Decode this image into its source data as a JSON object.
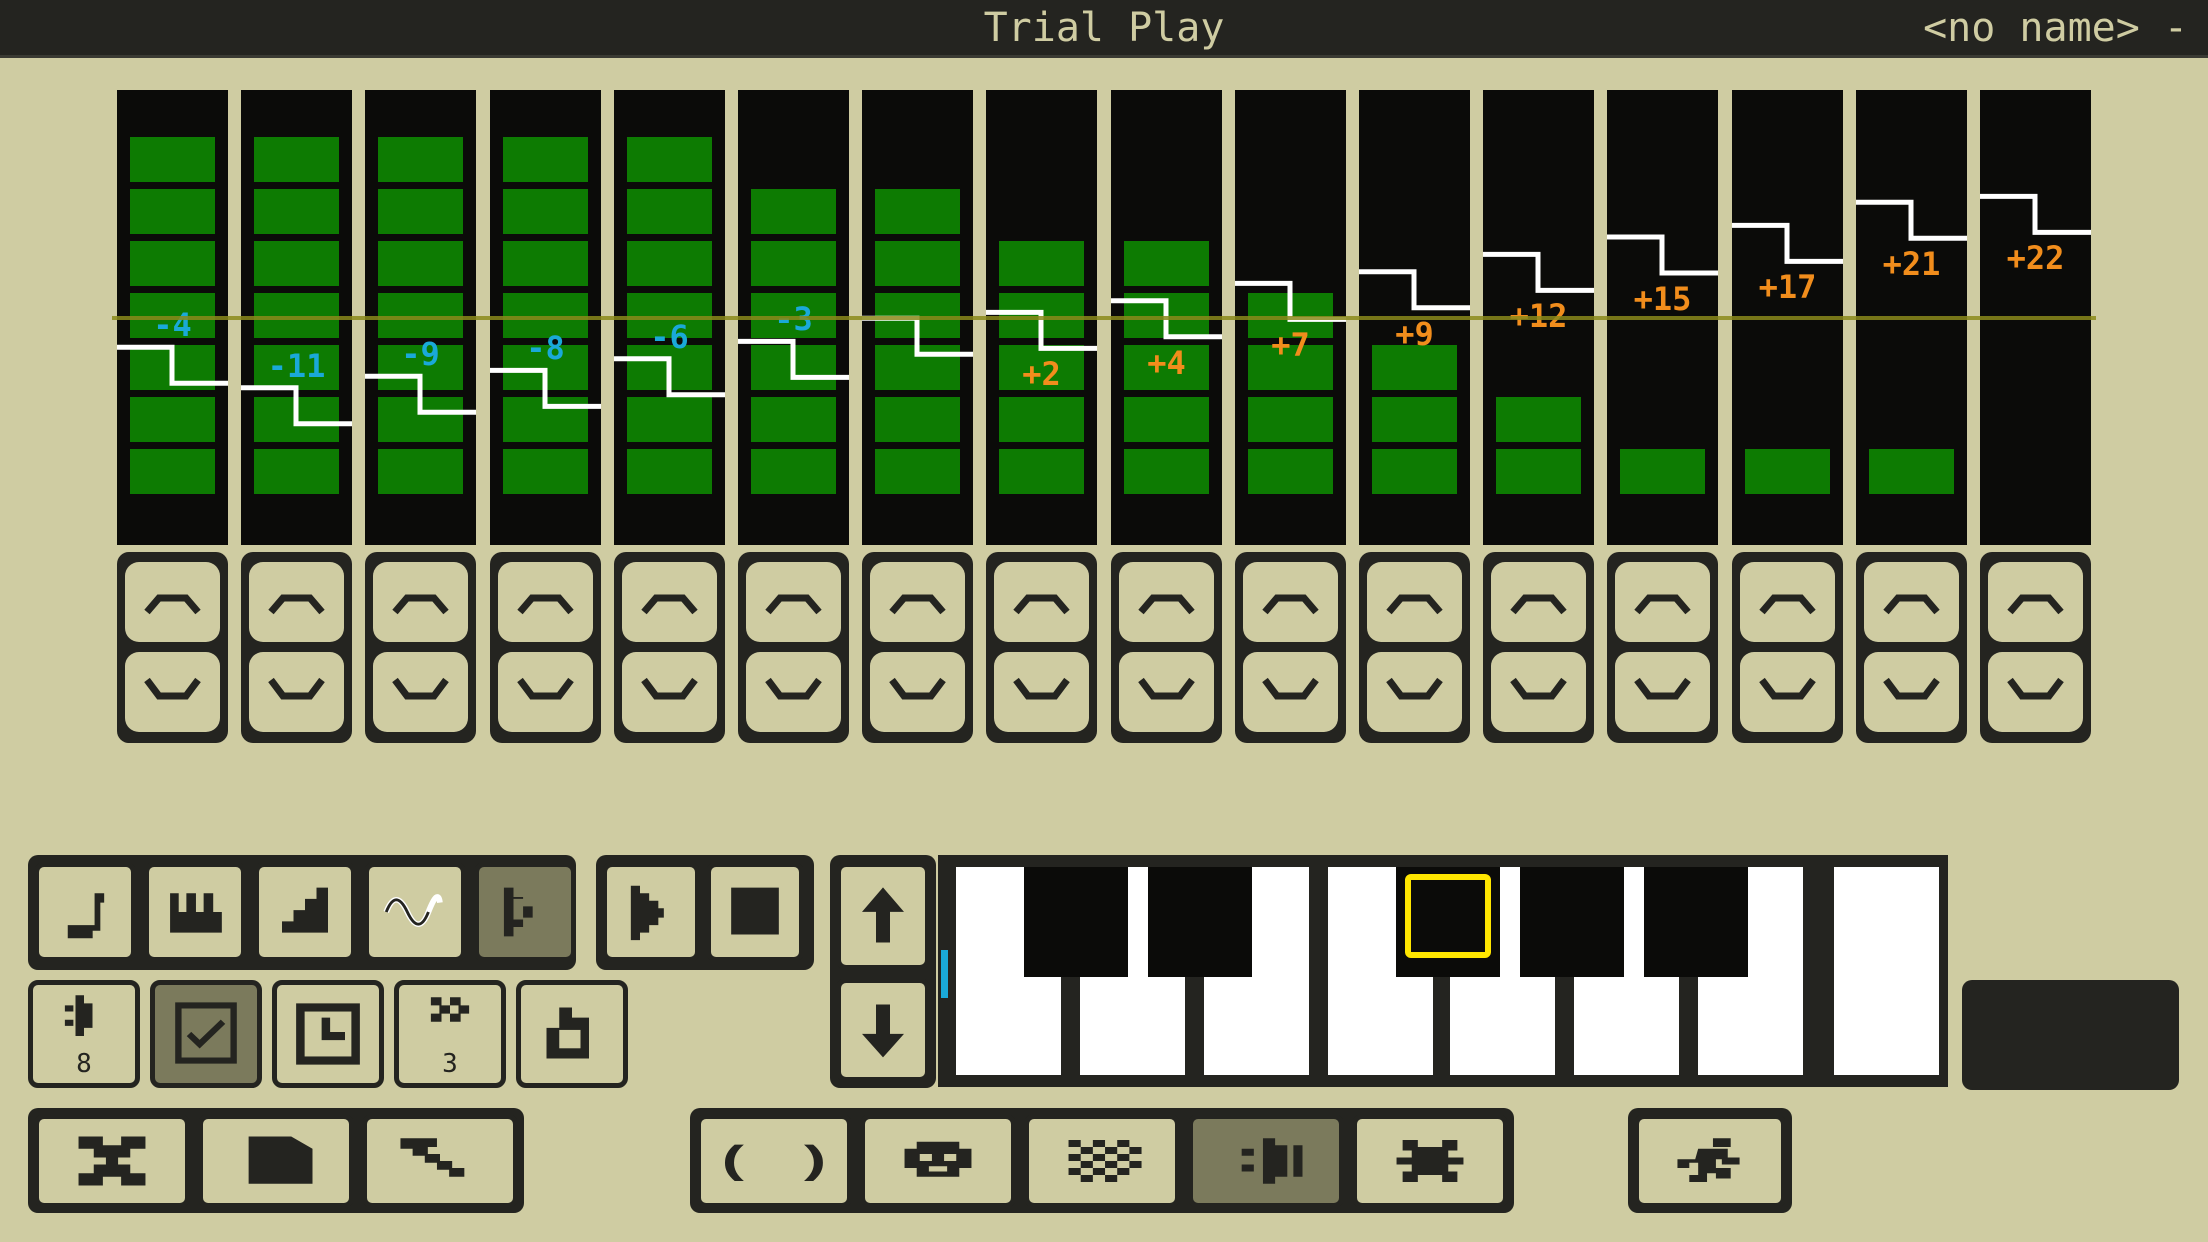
{
  "header": {
    "title": "Trial Play",
    "song_name": "<no name> -"
  },
  "stack": {
    "columns": [
      {
        "pitch_label": "-4",
        "block_count": 7
      },
      {
        "pitch_label": "-11",
        "block_count": 7
      },
      {
        "pitch_label": "-9",
        "block_count": 7
      },
      {
        "pitch_label": "-8",
        "block_count": 7
      },
      {
        "pitch_label": "-6",
        "block_count": 7
      },
      {
        "pitch_label": "-3",
        "block_count": 6
      },
      {
        "pitch_label": "",
        "block_count": 6
      },
      {
        "pitch_label": "+2",
        "block_count": 5
      },
      {
        "pitch_label": "+4",
        "block_count": 5
      },
      {
        "pitch_label": "+7",
        "block_count": 4
      },
      {
        "pitch_label": "+9",
        "block_count": 3
      },
      {
        "pitch_label": "+12",
        "block_count": 2
      },
      {
        "pitch_label": "+15",
        "block_count": 1
      },
      {
        "pitch_label": "+17",
        "block_count": 1
      },
      {
        "pitch_label": "+21",
        "block_count": 1
      },
      {
        "pitch_label": "+22",
        "block_count": 0
      }
    ],
    "pitch_up_icon": "chevron-up-icon",
    "pitch_down_icon": "chevron-down-icon"
  },
  "toolbar": {
    "mode_buttons": [
      {
        "icon": "note-icon"
      },
      {
        "icon": "piano-keys-icon"
      },
      {
        "icon": "stairs-icon"
      },
      {
        "icon": "sine-wave-icon"
      },
      {
        "icon": "fast-play-icon",
        "active": true
      }
    ],
    "transport_buttons": [
      {
        "icon": "play-icon"
      },
      {
        "icon": "stop-icon"
      }
    ],
    "option_buttons": [
      {
        "icon": "volume-icon",
        "label": "8"
      },
      {
        "icon": "check-icon",
        "active": true
      },
      {
        "icon": "clock-icon"
      },
      {
        "icon": "speed-icon",
        "label": "3"
      },
      {
        "icon": "undo-icon"
      }
    ],
    "octave_buttons": [
      {
        "icon": "arrow-up-icon"
      },
      {
        "icon": "arrow-down-icon"
      }
    ],
    "bottom_left_buttons": [
      {
        "icon": "exit-icon"
      },
      {
        "icon": "file-icon"
      },
      {
        "icon": "wrench-icon"
      }
    ],
    "editor_tabs": [
      {
        "icon": "brackets-icon",
        "label": "( )"
      },
      {
        "icon": "sprite-icon"
      },
      {
        "icon": "map-icon"
      },
      {
        "icon": "sound-icon",
        "active": true
      },
      {
        "icon": "music-icon"
      }
    ],
    "runner_button": {
      "icon": "runner-icon"
    }
  },
  "keyboard": {
    "white_keys": 8,
    "black_keys": 5,
    "octave_indicator_color": "#1aa9d8",
    "cursor_color": "#ffe600"
  },
  "colors": {
    "background": "#cfcca2",
    "dark": "#242420",
    "block_green": "#0d7b02",
    "negative_label": "#1aa9d8",
    "positive_label": "#f18d1c",
    "reference_line": "#8b8a1b"
  }
}
